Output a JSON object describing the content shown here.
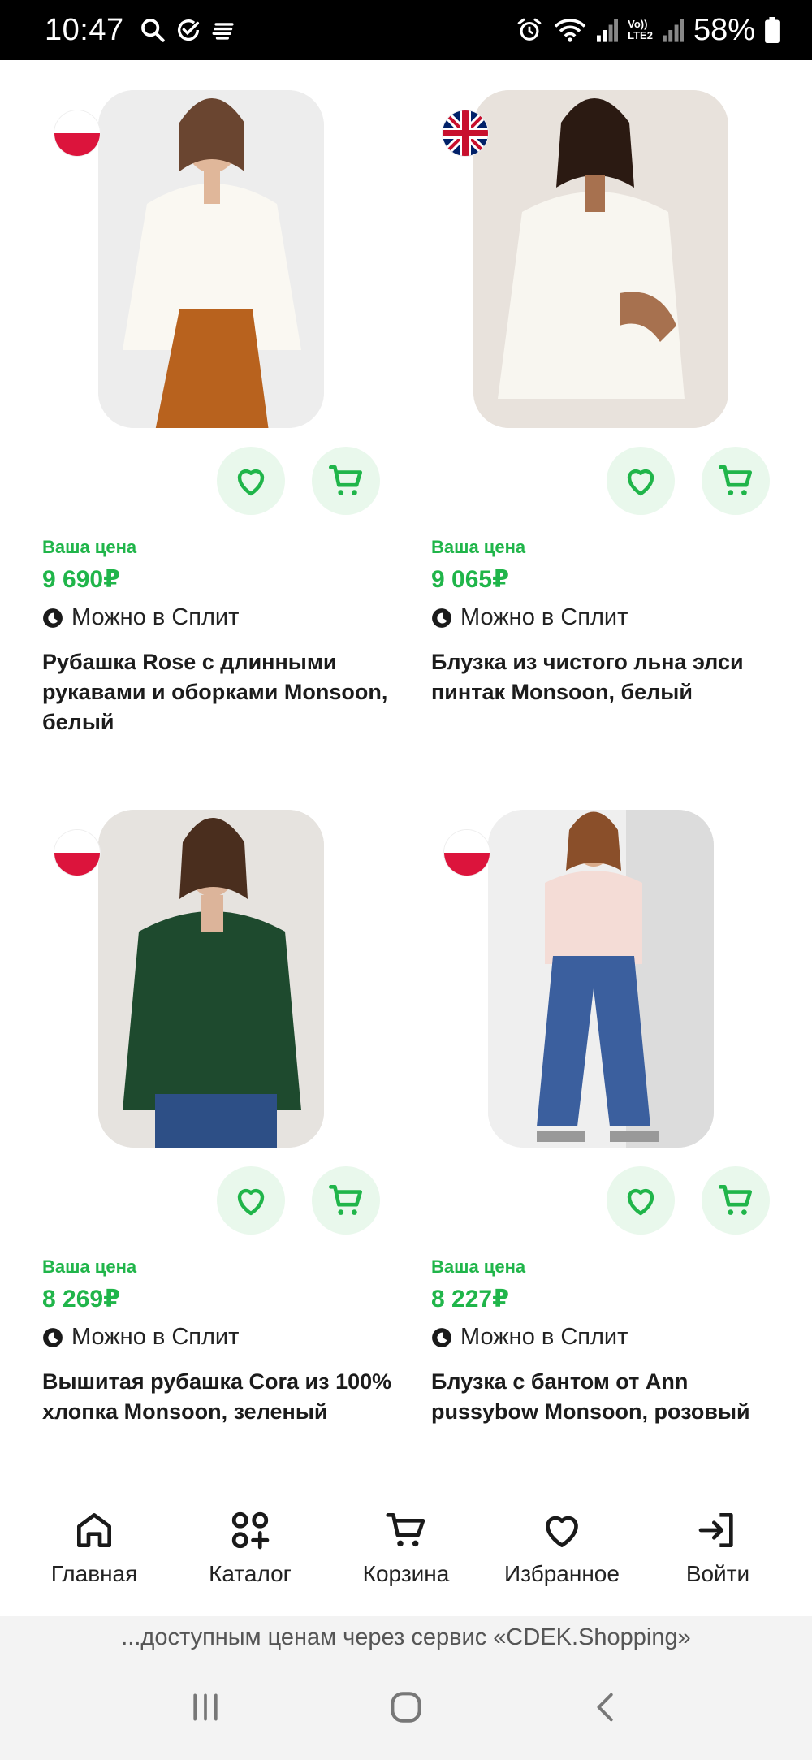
{
  "status_bar": {
    "time": "10:47",
    "battery": "58%",
    "icons": [
      "search-icon",
      "check-circle-icon",
      "notes-icon",
      "alarm-icon",
      "wifi-icon",
      "signal-icon",
      "lte-icon",
      "signal-icon",
      "battery-icon"
    ],
    "lte_label_top": "Vo))",
    "lte_label_bottom": "LTE2"
  },
  "products": [
    {
      "flag": "PL",
      "price_label": "Ваша цена",
      "price": "9 690₽",
      "split_text": "Можно в Сплит",
      "title": "Рубашка Rose с длинными рукавами и оборками Monsoon, белый",
      "image_desc": "white blouse"
    },
    {
      "flag": "GB",
      "price_label": "Ваша цена",
      "price": "9 065₽",
      "split_text": "Можно в Сплит",
      "title": "Блузка из чистого льна элси пинтак Monsoon, белый",
      "image_desc": "linen blouse"
    },
    {
      "flag": "PL",
      "price_label": "Ваша цена",
      "price": "8 269₽",
      "split_text": "Можно в Сплит",
      "title": "Вышитая рубашка Cora из 100% хлопка Monsoon, зеленый",
      "image_desc": "green blouse"
    },
    {
      "flag": "PL",
      "price_label": "Ваша цена",
      "price": "8 227₽",
      "split_text": "Можно в Сплит",
      "title": "Блузка с бантом от Ann pussybow Monsoon, розовый",
      "image_desc": "pink bow blouse"
    }
  ],
  "bottom_nav": {
    "items": [
      {
        "label": "Главная",
        "icon": "home-icon"
      },
      {
        "label": "Каталог",
        "icon": "catalog-icon"
      },
      {
        "label": "Корзина",
        "icon": "cart-icon"
      },
      {
        "label": "Избранное",
        "icon": "heart-icon"
      },
      {
        "label": "Войти",
        "icon": "login-icon"
      }
    ]
  },
  "promo_text": "...доступным ценам через сервис «CDEK.Shopping»",
  "colors": {
    "accent": "#20b54a",
    "accent_bg": "#e9f8ec"
  }
}
